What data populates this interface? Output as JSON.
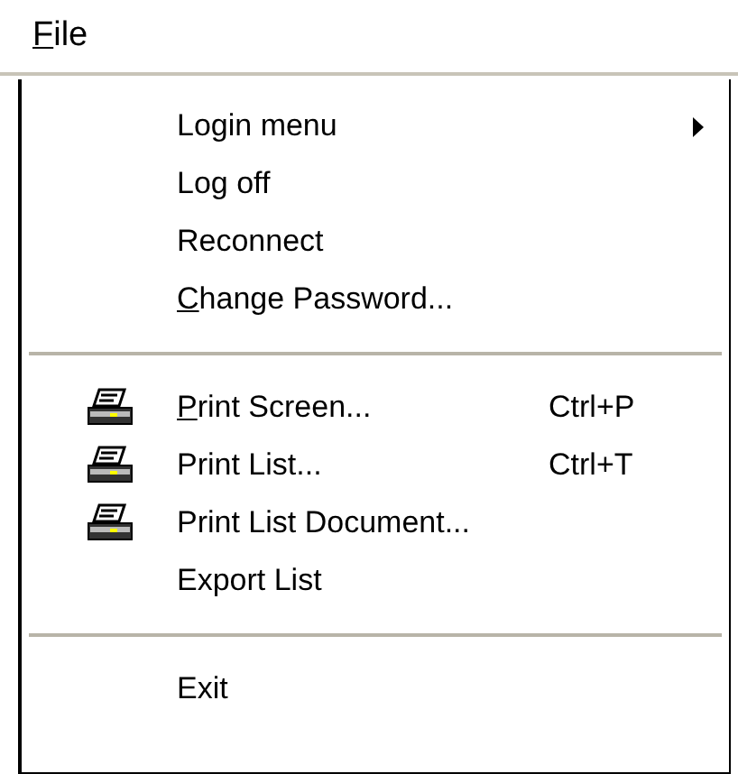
{
  "menubar": [
    {
      "label": "File",
      "underline_first": true
    }
  ],
  "menu": [
    {
      "kind": "item",
      "label": "Login menu",
      "underline_first": false,
      "submenu": true
    },
    {
      "kind": "item",
      "label": "Log off",
      "underline_first": false
    },
    {
      "kind": "item",
      "label": "Reconnect",
      "underline_first": false
    },
    {
      "kind": "item",
      "label": "Change Password...",
      "underline_first": true
    },
    {
      "kind": "separator"
    },
    {
      "kind": "printer_item",
      "label": "Print Screen...",
      "underline_first": true,
      "shortcut": "Ctrl+P"
    },
    {
      "kind": "printer_item",
      "label": "Print List...",
      "underline_first": false,
      "shortcut": "Ctrl+T"
    },
    {
      "kind": "printer_item",
      "label": "Print List Document...",
      "underline_first": false
    },
    {
      "kind": "item",
      "label": "Export List",
      "underline_first": false
    },
    {
      "kind": "separator"
    },
    {
      "kind": "item",
      "label": "Exit",
      "underline_first": false
    }
  ]
}
